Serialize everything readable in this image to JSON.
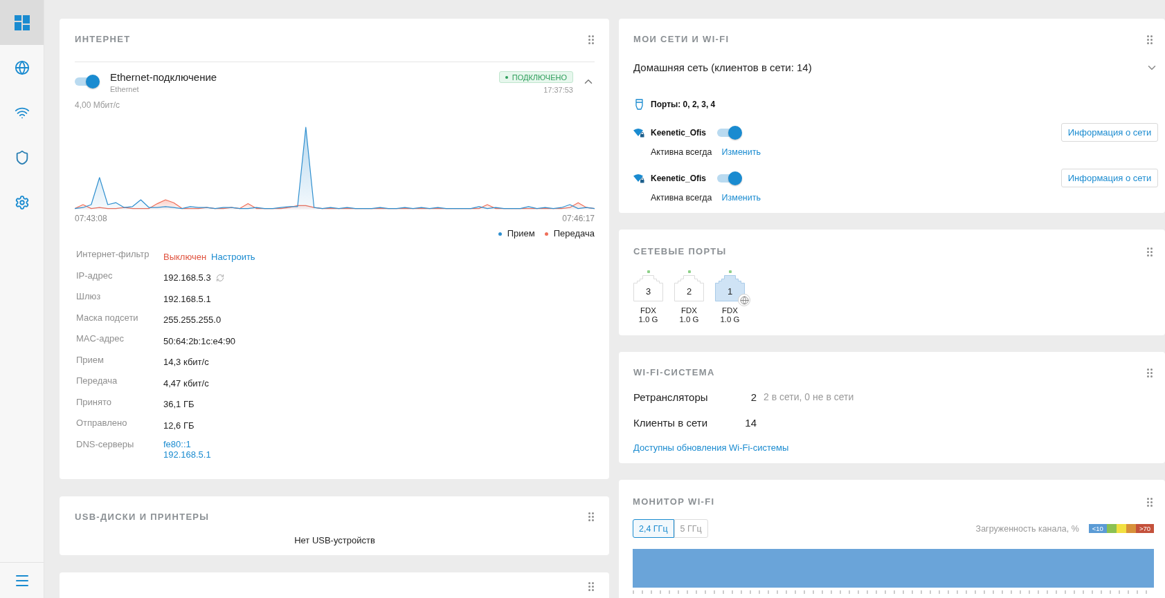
{
  "sidebar": {
    "items": [
      {
        "kind": "dashboard",
        "selected": true
      },
      {
        "kind": "internet",
        "selected": false
      },
      {
        "kind": "wifi",
        "selected": false
      },
      {
        "kind": "security",
        "selected": false
      },
      {
        "kind": "settings",
        "selected": false
      }
    ]
  },
  "internet": {
    "title": "ИНТЕРНЕТ",
    "connection": {
      "on": true,
      "name": "Ethernet-подключение",
      "type": "Ethernet",
      "status": {
        "kind": "connected",
        "label": "ПОДКЛЮЧЕНО"
      },
      "time": "17:37:53",
      "expanded": true
    },
    "traffic": {
      "scale": "4,00 Мбит/с",
      "start_time": "07:43:08",
      "end_time": "07:46:17",
      "legend": [
        {
          "label": "Прием",
          "color": "#2f8fcf"
        },
        {
          "label": "Передача",
          "color": "#ef6f5a"
        }
      ]
    },
    "details": [
      {
        "label": "Интернет-фильтр",
        "kind": "inline",
        "values": [
          {
            "text": "Выключен",
            "kind": "alert"
          },
          {
            "text": "Настроить",
            "kind": "link"
          }
        ]
      },
      {
        "label": "IP-адрес",
        "kind": "inline",
        "values": [
          {
            "text": "192.168.5.3",
            "kind": "plain"
          },
          {
            "kind": "refresh"
          }
        ]
      },
      {
        "label": "Шлюз",
        "kind": "inline",
        "values": [
          {
            "text": "192.168.5.1",
            "kind": "plain"
          }
        ]
      },
      {
        "label": "Маска подсети",
        "kind": "inline",
        "values": [
          {
            "text": "255.255.255.0",
            "kind": "plain"
          }
        ]
      },
      {
        "label": "MAC-адрес",
        "kind": "inline",
        "values": [
          {
            "text": "50:64:2b:1c:e4:90",
            "kind": "plain"
          }
        ]
      },
      {
        "label": "Прием",
        "kind": "inline",
        "values": [
          {
            "text": "14,3 кбит/с",
            "kind": "plain"
          }
        ]
      },
      {
        "label": "Передача",
        "kind": "inline",
        "values": [
          {
            "text": "4,47 кбит/с",
            "kind": "plain"
          }
        ]
      },
      {
        "label": "Принято",
        "kind": "inline",
        "values": [
          {
            "text": "36,1 ГБ",
            "kind": "plain"
          }
        ]
      },
      {
        "label": "Отправлено",
        "kind": "inline",
        "values": [
          {
            "text": "12,6 ГБ",
            "kind": "plain"
          }
        ]
      },
      {
        "label": "DNS-серверы",
        "kind": "list",
        "values": [
          {
            "text": "fe80::1",
            "kind": "link"
          },
          {
            "text": "192.168.5.1",
            "kind": "link"
          }
        ]
      }
    ]
  },
  "usb": {
    "title": "USB-ДИСКИ И ПРИНТЕРЫ",
    "empty_text": "Нет USB-устройств"
  },
  "my_networks": {
    "title": "МОИ СЕТИ И WI-FI",
    "segment": {
      "name": "Домашняя сеть (клиентов в сети: 14)",
      "expanded": false
    },
    "ports": "Порты: 0, 2, 3, 4",
    "wifi": [
      {
        "ssid": "Keenetic_Ofis",
        "on": true,
        "schedule": "Активна всегда",
        "edit": "Изменить",
        "info": "Информация о сети"
      },
      {
        "ssid": "Keenetic_Ofis",
        "on": true,
        "schedule": "Активна всегда",
        "edit": "Изменить",
        "info": "Информация о сети"
      }
    ]
  },
  "network_ports": {
    "title": "СЕТЕВЫЕ ПОРТЫ",
    "ports": [
      {
        "number": "3",
        "link": true,
        "wan": false,
        "duplex": "FDX",
        "speed": "1.0 G"
      },
      {
        "number": "2",
        "link": true,
        "wan": false,
        "duplex": "FDX",
        "speed": "1.0 G"
      },
      {
        "number": "1",
        "link": true,
        "wan": true,
        "duplex": "FDX",
        "speed": "1.0 G"
      }
    ]
  },
  "wifi_system": {
    "title": "WI-FI-СИСТЕМА",
    "rows": [
      {
        "label": "Ретрансляторы",
        "value": "2",
        "note": "2 в сети, 0 не в сети"
      },
      {
        "label": "Клиенты в сети",
        "value": "14"
      }
    ],
    "update_link": "Доступны обновления Wi-Fi-системы"
  },
  "wifi_monitor": {
    "title": "МОНИТОР WI-FI",
    "bands": [
      {
        "label": "2,4 ГГц",
        "selected": true
      },
      {
        "label": "5 ГГц",
        "selected": false
      }
    ],
    "load_label": "Загруженность канала, %",
    "load_scale": [
      {
        "label": "<10",
        "color": "#5b9bd5"
      },
      {
        "color": "#8cc152"
      },
      {
        "color": "#f2e041"
      },
      {
        "color": "#d8913a"
      },
      {
        "label": ">70",
        "color": "#c4513b"
      }
    ]
  }
}
